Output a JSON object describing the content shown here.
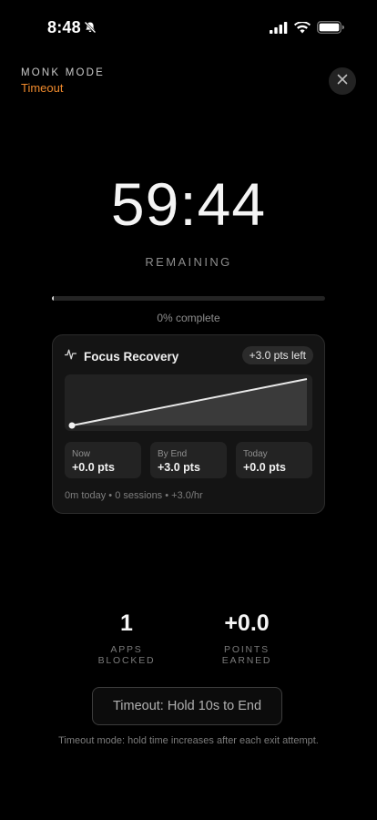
{
  "status_bar": {
    "time": "8:48"
  },
  "header": {
    "mode_label": "MONK MODE",
    "mode_sub": "Timeout"
  },
  "timer": {
    "value": "59:44",
    "remaining_label": "REMAINING",
    "progress_fraction": 0.006,
    "progress_label": "0% complete"
  },
  "focus_card": {
    "title": "Focus Recovery",
    "badge": "+3.0 pts left",
    "chart_data": {
      "type": "area",
      "x": [
        0,
        1
      ],
      "y": [
        0.0,
        3.0
      ]
    },
    "stats": [
      {
        "label": "Now",
        "value": "+0.0 pts"
      },
      {
        "label": "By End",
        "value": "+3.0 pts"
      },
      {
        "label": "Today",
        "value": "+0.0 pts"
      }
    ],
    "footer": "0m today • 0 sessions • +3.0/hr"
  },
  "summary": {
    "apps_blocked": "1",
    "apps_blocked_label": "APPS BLOCKED",
    "points_earned": "+0.0",
    "points_earned_label": "POINTS EARNED"
  },
  "end_button_label": "Timeout: Hold 10s to End",
  "footnote": "Timeout mode: hold time increases after each exit attempt.",
  "colors": {
    "accent": "#f08a2c",
    "background": "#000000",
    "card": "#141414"
  }
}
